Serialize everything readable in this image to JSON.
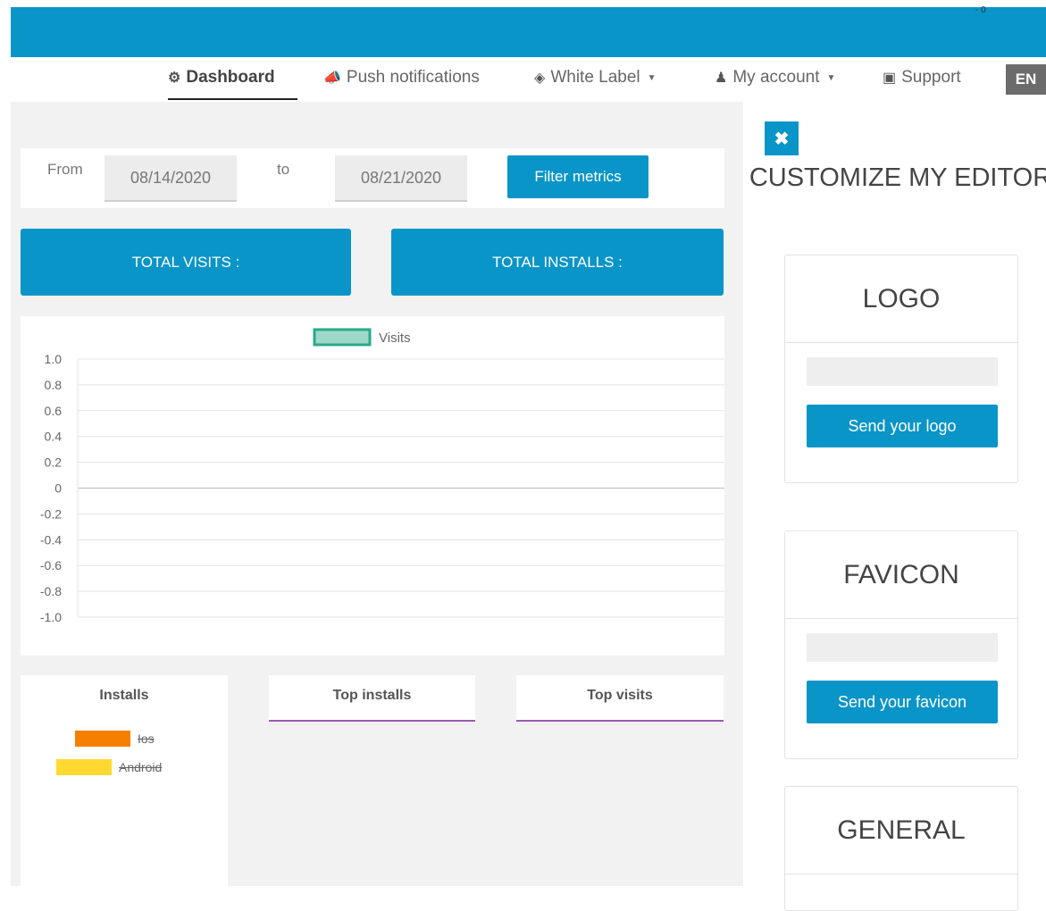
{
  "topbar": {
    "corner_text": "- 0"
  },
  "nav": {
    "items": [
      {
        "label": "Dashboard",
        "icon": "dashboard-icon",
        "glyph": "⚙"
      },
      {
        "label": "Push notifications",
        "icon": "bullhorn-icon",
        "glyph": "📢"
      },
      {
        "label": "White Label",
        "icon": "tags-icon",
        "glyph": "🏷"
      },
      {
        "label": "My account",
        "icon": "user-icon",
        "glyph": "👤"
      },
      {
        "label": "Support",
        "icon": "medkit-icon",
        "glyph": "⚕"
      }
    ],
    "lang": "EN"
  },
  "filters": {
    "from_label": "From",
    "from_value": "08/14/2020",
    "to_label": "to",
    "to_value": "08/21/2020",
    "button": "Filter metrics"
  },
  "stats": {
    "visits_label": "TOTAL VISITS :",
    "installs_label": "TOTAL INSTALLS :"
  },
  "chart_data": {
    "type": "line",
    "series": [
      {
        "name": "Visits",
        "values": []
      }
    ],
    "ylim": [
      -1.0,
      1.0
    ],
    "y_ticks": [
      "1.0",
      "0.8",
      "0.6",
      "0.4",
      "0.2",
      "0",
      "-0.2",
      "-0.4",
      "-0.6",
      "-0.8",
      "-1.0"
    ],
    "legend_position": "top-center",
    "grid": true,
    "colors": {
      "Visits": "#9fd8c9",
      "Visits_border": "#2aaa8a"
    }
  },
  "tabs": {
    "installs": "Installs",
    "top_installs": "Top installs",
    "top_visits": "Top visits"
  },
  "installs_legend": [
    {
      "label": "Ios",
      "color": "#f77f00"
    },
    {
      "label": "Android",
      "color": "#ffd92f"
    }
  ],
  "sidebar": {
    "title": "CUSTOMIZE MY EDITOR",
    "logo_title": "LOGO",
    "logo_button": "Send your logo",
    "favicon_title": "FAVICON",
    "favicon_button": "Send your favicon",
    "general_title": "GENERAL"
  }
}
